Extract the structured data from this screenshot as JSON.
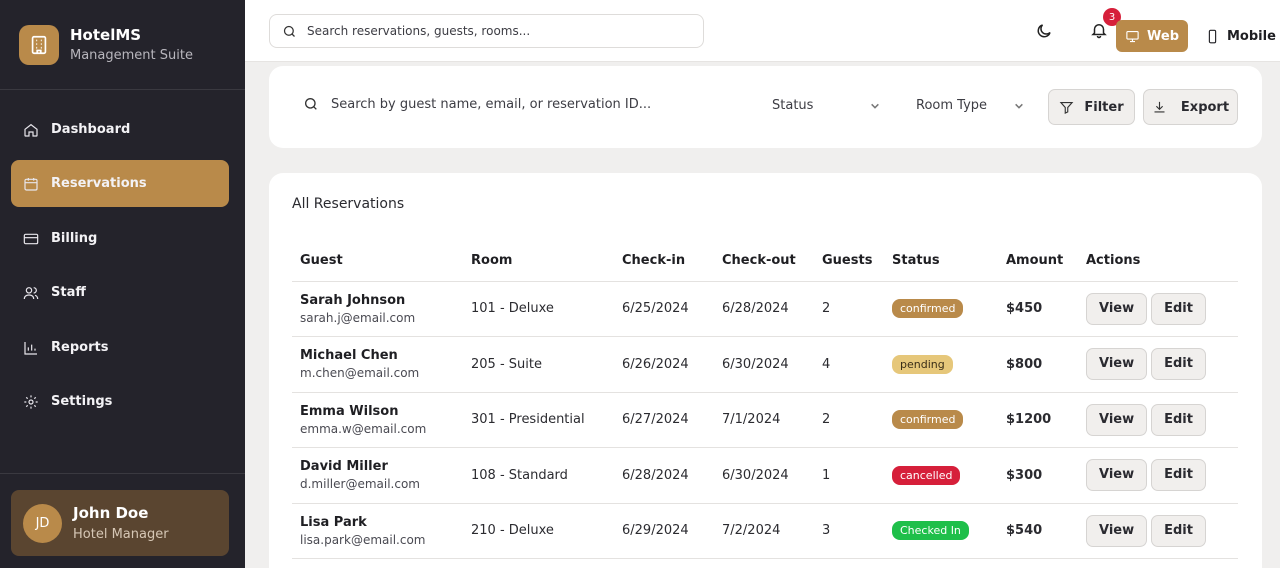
{
  "brand": {
    "name": "HotelMS",
    "subtitle": "Management Suite"
  },
  "nav": [
    {
      "label": "Dashboard",
      "icon": "home-icon",
      "active": false
    },
    {
      "label": "Reservations",
      "icon": "calendar-icon",
      "active": true
    },
    {
      "label": "Billing",
      "icon": "credit-card-icon",
      "active": false
    },
    {
      "label": "Staff",
      "icon": "users-icon",
      "active": false
    },
    {
      "label": "Reports",
      "icon": "bar-chart-icon",
      "active": false
    },
    {
      "label": "Settings",
      "icon": "gear-icon",
      "active": false
    }
  ],
  "user": {
    "initials": "JD",
    "name": "John Doe",
    "role": "Hotel Manager"
  },
  "topbar": {
    "search_placeholder": "Search reservations, guests, rooms...",
    "notification_count": "3",
    "view_web": "Web",
    "view_mobile": "Mobile"
  },
  "filters": {
    "search_placeholder": "Search by guest name, email, or reservation ID...",
    "status_label": "Status",
    "room_type_label": "Room Type",
    "filter_label": "Filter",
    "export_label": "Export"
  },
  "reservations": {
    "title": "All Reservations",
    "columns": [
      "Guest",
      "Room",
      "Check-in",
      "Check-out",
      "Guests",
      "Status",
      "Amount",
      "Actions"
    ],
    "rows": [
      {
        "name": "Sarah Johnson",
        "email": "sarah.j@email.com",
        "room": "101 - Deluxe",
        "checkin": "6/25/2024",
        "checkout": "6/28/2024",
        "guests": "2",
        "status": "confirmed",
        "amount": "$450"
      },
      {
        "name": "Michael Chen",
        "email": "m.chen@email.com",
        "room": "205 - Suite",
        "checkin": "6/26/2024",
        "checkout": "6/30/2024",
        "guests": "4",
        "status": "pending",
        "amount": "$800"
      },
      {
        "name": "Emma Wilson",
        "email": "emma.w@email.com",
        "room": "301 - Presidential",
        "checkin": "6/27/2024",
        "checkout": "7/1/2024",
        "guests": "2",
        "status": "confirmed",
        "amount": "$1200"
      },
      {
        "name": "David Miller",
        "email": "d.miller@email.com",
        "room": "108 - Standard",
        "checkin": "6/28/2024",
        "checkout": "6/30/2024",
        "guests": "1",
        "status": "cancelled",
        "amount": "$300"
      },
      {
        "name": "Lisa Park",
        "email": "lisa.park@email.com",
        "room": "210 - Deluxe",
        "checkin": "6/29/2024",
        "checkout": "7/2/2024",
        "guests": "3",
        "status": "Checked In",
        "amount": "$540"
      }
    ],
    "view_label": "View",
    "edit_label": "Edit"
  },
  "colors": {
    "accent": "#b98a4a",
    "sidebar": "#24232b",
    "status_confirmed": "#b98a4a",
    "status_pending": "#e6c77a",
    "status_cancelled": "#d61f3a",
    "status_checked_in": "#1fbf4a"
  }
}
